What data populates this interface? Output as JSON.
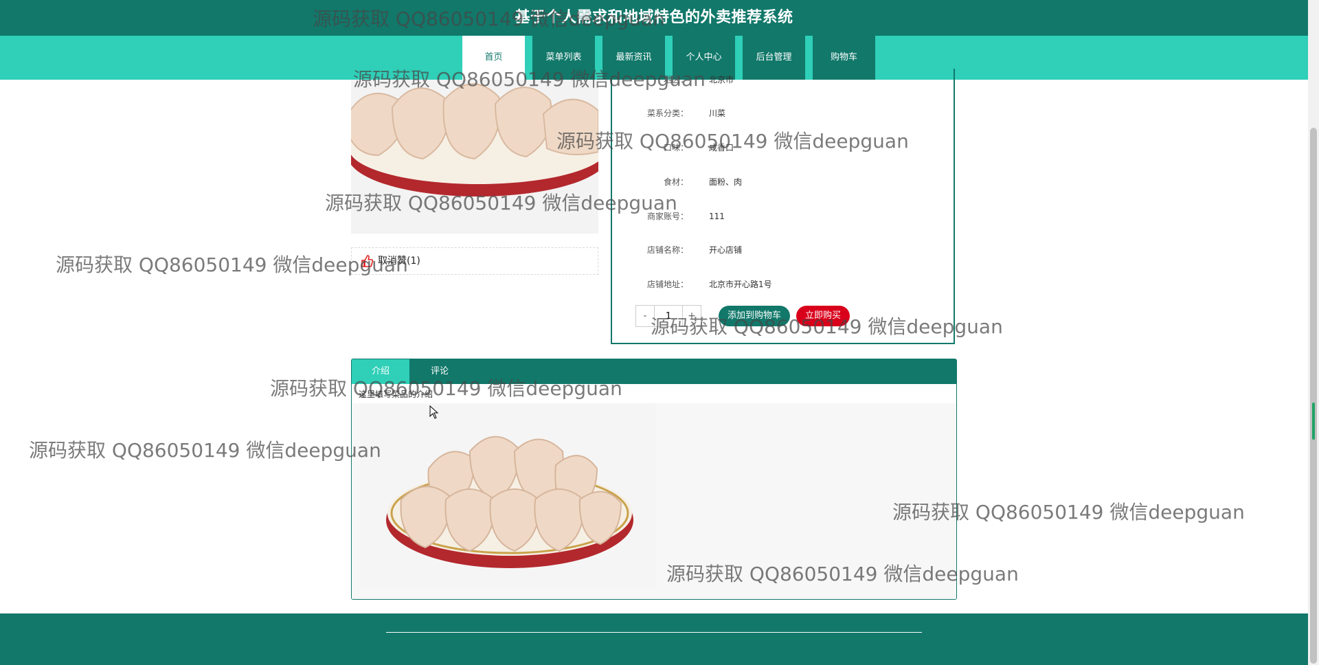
{
  "header": {
    "site_title": "基于个人需求和地域特色的外卖推荐系统"
  },
  "nav": [
    {
      "label": "首页",
      "active": true
    },
    {
      "label": "菜单列表",
      "active": false
    },
    {
      "label": "最新资讯",
      "active": false
    },
    {
      "label": "个人中心",
      "active": false
    },
    {
      "label": "后台管理",
      "active": false
    },
    {
      "label": "购物车",
      "active": false
    }
  ],
  "product": {
    "image_icon": "dumplings-image",
    "like_label": "取消赞(1)",
    "fields": [
      {
        "label": "地区：",
        "value": "北京市"
      },
      {
        "label": "菜系分类：",
        "value": "川菜"
      },
      {
        "label": "口味：",
        "value": "咸香口"
      },
      {
        "label": "食材：",
        "value": "面粉、肉"
      },
      {
        "label": "商家账号：",
        "value": "111"
      },
      {
        "label": "店铺名称：",
        "value": "开心店铺"
      },
      {
        "label": "店铺地址：",
        "value": "北京市开心路1号"
      }
    ],
    "quantity": "1",
    "qty_minus": "-",
    "qty_plus": "+",
    "add_to_cart_label": "添加到购物车",
    "buy_now_label": "立即购买"
  },
  "detail": {
    "tabs": [
      {
        "label": "介绍",
        "active": true
      },
      {
        "label": "评论",
        "active": false
      }
    ],
    "intro_text": "这里填写菜品的介绍"
  },
  "watermark": {
    "text": "源码获取 QQ86050149 微信deepguan"
  },
  "colors": {
    "primary_dark": "#11786a",
    "primary_light": "#2fcfb8",
    "buy_red": "#d9001b"
  }
}
